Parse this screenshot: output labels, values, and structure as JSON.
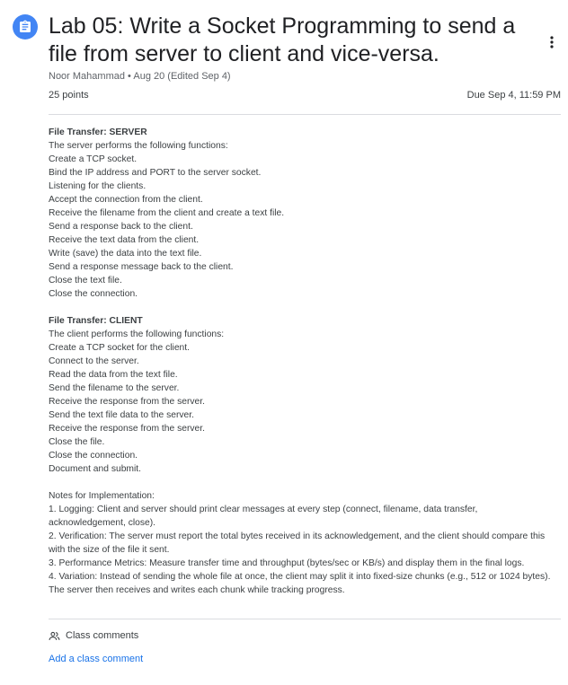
{
  "assignment": {
    "icon": "assignment-icon",
    "title": "Lab 05: Write a Socket Programming to send a file from server to client and vice-versa.",
    "author": "Noor Mahammad",
    "separator": "•",
    "posted": "Aug 20 (Edited Sep 4)",
    "points": "25 points",
    "due": "Due Sep 4, 11:59 PM",
    "colors": {
      "icon_bg": "#4285f4",
      "link": "#1a73e8"
    }
  },
  "description": {
    "server": {
      "heading": "File Transfer: SERVER",
      "lines": [
        "The server performs the following functions:",
        "Create a TCP socket.",
        "Bind the IP address and PORT to the server socket.",
        "Listening for the clients.",
        "Accept the connection from the client.",
        "Receive the filename from the client and create a text file.",
        "Send a response back to the client.",
        "Receive the text data from the client.",
        "Write (save) the data into the text file.",
        "Send a response message back to the client.",
        "Close the text file.",
        "Close the connection."
      ]
    },
    "client": {
      "heading": "File Transfer: CLIENT",
      "lines": [
        "The client performs the following functions:",
        "Create a TCP socket for the client.",
        "Connect to the server.",
        "Read the data from the text file.",
        "Send the filename to the server.",
        "Receive the response from the server.",
        "Send the text file data to the server.",
        "Receive the response from the server.",
        "Close the file.",
        "Close the connection.",
        "Document and submit."
      ]
    },
    "notes": {
      "heading": "Notes for Implementation:",
      "lines": [
        "1. Logging: Client and server should print clear messages at every step (connect, filename, data transfer, acknowledgement, close).",
        "2. Verification: The server must report the total bytes received in its acknowledgement, and the client should compare this with the size of the file it sent.",
        "3. Performance Metrics: Measure transfer time and throughput (bytes/sec or KB/s) and display them in the final logs.",
        "4. Variation: Instead of sending the whole file at once, the client may split it into fixed-size chunks (e.g., 512 or 1024 bytes). The server then receives and writes each chunk while tracking progress."
      ]
    }
  },
  "comments": {
    "icon": "people-icon",
    "label": "Class comments",
    "add_label": "Add a class comment"
  },
  "menu": {
    "icon": "more-vert-icon"
  }
}
